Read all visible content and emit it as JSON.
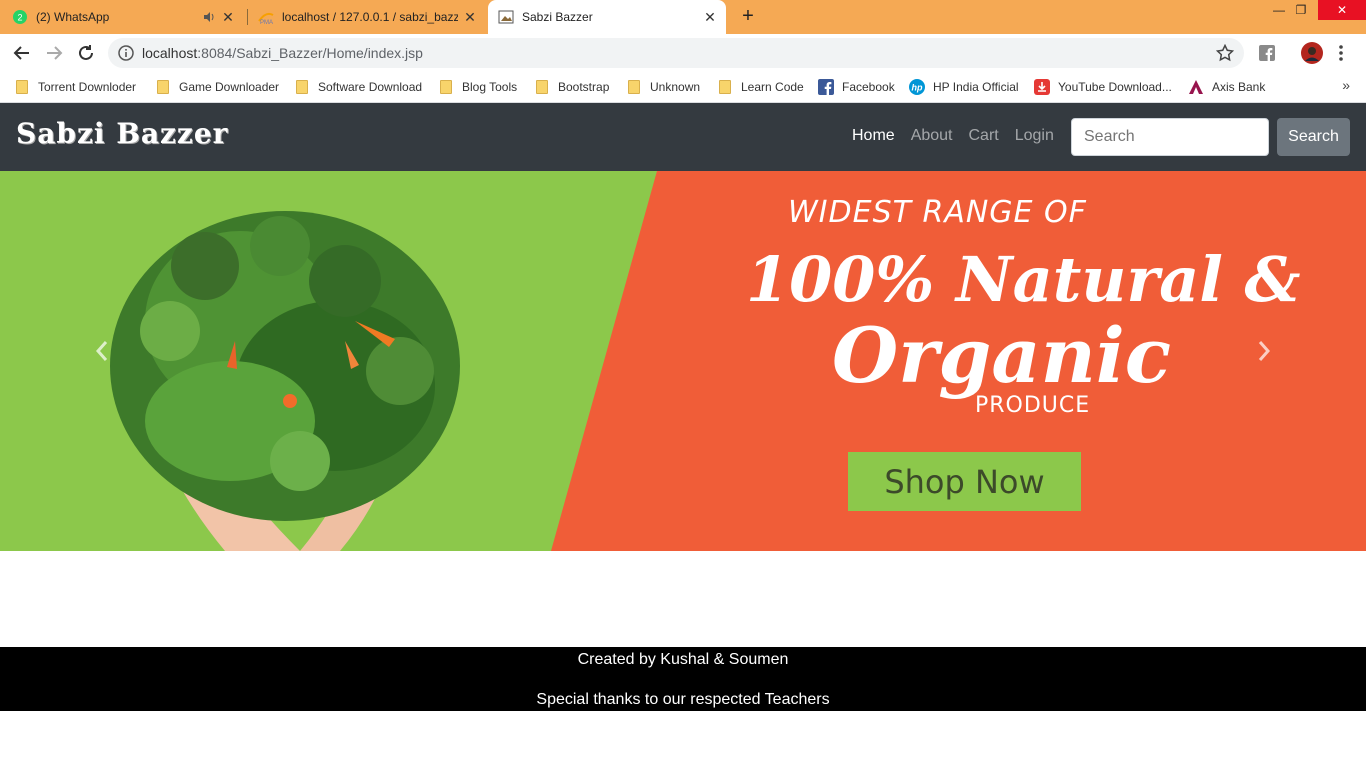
{
  "browser": {
    "tabs": [
      {
        "title": "(2) WhatsApp",
        "icon": "whatsapp-icon",
        "muted": true
      },
      {
        "title": "localhost / 127.0.0.1 / sabzi_bazzer",
        "icon": "phpmyadmin-icon"
      },
      {
        "title": "Sabzi Bazzer",
        "icon": "page-icon",
        "active": true
      }
    ],
    "url_host": "localhost",
    "url_path": ":8084/Sabzi_Bazzer/Home/index.jsp",
    "bookmarks": [
      {
        "label": "Torrent Downloder",
        "icon": "folder-icon"
      },
      {
        "label": "Game Downloader",
        "icon": "folder-icon"
      },
      {
        "label": "Software Download",
        "icon": "folder-icon"
      },
      {
        "label": "Blog Tools",
        "icon": "folder-icon"
      },
      {
        "label": "Bootstrap",
        "icon": "folder-icon"
      },
      {
        "label": "Unknown",
        "icon": "folder-icon"
      },
      {
        "label": "Learn Code",
        "icon": "folder-icon"
      },
      {
        "label": "Facebook",
        "icon": "facebook-icon"
      },
      {
        "label": "HP India Official",
        "icon": "hp-icon"
      },
      {
        "label": "YouTube Download...",
        "icon": "download-icon"
      },
      {
        "label": "Axis Bank",
        "icon": "axis-bank-icon"
      }
    ],
    "bookmarks_more": "»"
  },
  "navbar": {
    "brand": "Sabzi Bazzer",
    "links": [
      "Home",
      "About",
      "Cart",
      "Login"
    ],
    "active_link": "Home",
    "search_placeholder": "Search",
    "search_button": "Search"
  },
  "banner": {
    "line1": "WIDEST RANGE OF",
    "line2": "100% Natural &",
    "line3": "Organic",
    "line4": "PRODUCE",
    "cta": "Shop Now",
    "colors": {
      "green": "#8cc84b",
      "orange": "#f05d38"
    }
  },
  "footer": {
    "credit": "Created by Kushal & Soumen",
    "thanks": "Special thanks to our respected Teachers"
  }
}
